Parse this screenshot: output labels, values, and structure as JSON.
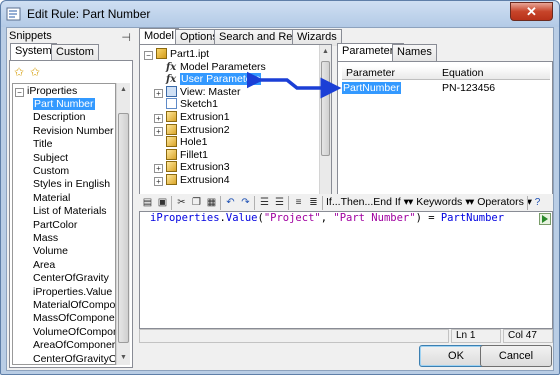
{
  "window": {
    "title": "Edit Rule: Part Number",
    "close_label": "✕"
  },
  "snippets": {
    "header": "Snippets",
    "tabs": [
      "System",
      "Custom"
    ],
    "active_tab": "System",
    "tree_root": "iProperties",
    "items": [
      "Part Number",
      "Description",
      "Revision Number",
      "Title",
      "Subject",
      "Custom",
      "Styles in English",
      "Material",
      "List of Materials",
      "PartColor",
      "Mass",
      "Volume",
      "Area",
      "CenterOfGravity",
      "iProperties.Value",
      "MaterialOfCompo",
      "MassOfComponer",
      "VolumeOfCompon",
      "AreaOfComponer",
      "CenterOfGravityO"
    ],
    "selected": "Part Number"
  },
  "model": {
    "tabs": [
      "Model",
      "Options",
      "Search and Replace",
      "Wizards"
    ],
    "active_tab": "Model",
    "tree": [
      {
        "label": "Part1.ipt",
        "icon": "part-icon",
        "expander": "−",
        "level": 0
      },
      {
        "label": "Model Parameters",
        "icon": "fx-icon",
        "expander": "",
        "level": 1
      },
      {
        "label": "User Parameters",
        "icon": "fx-icon",
        "expander": "",
        "level": 1,
        "selected": true
      },
      {
        "label": "View: Master",
        "icon": "view-icon",
        "expander": "+",
        "level": 1
      },
      {
        "label": "Sketch1",
        "icon": "sketch-icon",
        "expander": "",
        "level": 1
      },
      {
        "label": "Extrusion1",
        "icon": "feature-icon",
        "expander": "+",
        "level": 1
      },
      {
        "label": "Extrusion2",
        "icon": "feature-icon",
        "expander": "+",
        "level": 1
      },
      {
        "label": "Hole1",
        "icon": "feature-icon",
        "expander": "",
        "level": 1
      },
      {
        "label": "Fillet1",
        "icon": "feature-icon",
        "expander": "",
        "level": 1
      },
      {
        "label": "Extrusion3",
        "icon": "feature-icon",
        "expander": "+",
        "level": 1
      },
      {
        "label": "Extrusion4",
        "icon": "feature-icon",
        "expander": "+",
        "level": 1
      }
    ]
  },
  "params": {
    "tabs": [
      "Parameters",
      "Names"
    ],
    "active_tab": "Parameters",
    "columns": [
      "Parameter",
      "Equation"
    ],
    "rows": [
      {
        "parameter": "PartNumber",
        "equation": "PN-123456"
      }
    ]
  },
  "toolbar": {
    "if_then": "If...Then...End If",
    "keywords": "Keywords",
    "operators": "Operators"
  },
  "editor": {
    "code_parts": [
      "iProperties",
      ".",
      "Value",
      "(",
      "\"Project\"",
      ", ",
      "\"Part Number\"",
      ") = ",
      "PartNumber"
    ]
  },
  "status": {
    "line": "Ln 1",
    "col": "Col 47"
  },
  "buttons": {
    "ok": "OK",
    "cancel": "Cancel"
  },
  "colors": {
    "selection": "#3399ff",
    "arrow": "#1b3fd6"
  }
}
